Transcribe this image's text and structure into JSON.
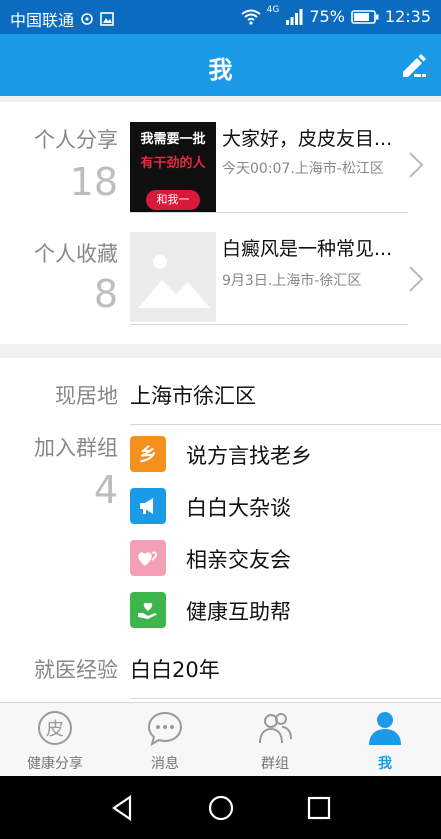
{
  "status_bar": {
    "carrier": "中国联通",
    "network": "4G",
    "battery": "75%",
    "time": "12:35"
  },
  "header": {
    "title": "我",
    "edit_icon": "edit-pencil-icon"
  },
  "share": {
    "label": "个人分享",
    "count": "18",
    "item_title": "大家好，皮皮友目...",
    "item_meta": "今天00:07.上海市-松江区",
    "thumb_lines": [
      "我需要一批",
      "有干劲的人",
      "和我一"
    ]
  },
  "favorite": {
    "label": "个人收藏",
    "count": "8",
    "item_title": "白癜风是一种常见...",
    "item_meta": "9月3日.上海市-徐汇区"
  },
  "residence": {
    "label": "现居地",
    "value": "上海市徐汇区"
  },
  "groups": {
    "label": "加入群组",
    "count": "4",
    "items": [
      {
        "name": "说方言找老乡",
        "icon": "hometown-icon",
        "color": "#f5901e",
        "glyph": "乡"
      },
      {
        "name": "白白大杂谈",
        "icon": "megaphone-icon",
        "color": "#1b9ae8"
      },
      {
        "name": "相亲交友会",
        "icon": "hearts-icon",
        "color": "#f4a0b4"
      },
      {
        "name": "健康互助帮",
        "icon": "helping-hand-icon",
        "color": "#3cb54a"
      }
    ]
  },
  "experience": {
    "label": "就医经验",
    "value": "白白20年"
  },
  "tabs": [
    {
      "label": "健康分享",
      "icon": "share-skin-icon",
      "glyph": "皮"
    },
    {
      "label": "消息",
      "icon": "message-bubble-icon"
    },
    {
      "label": "群组",
      "icon": "group-people-icon"
    },
    {
      "label": "我",
      "icon": "person-icon",
      "active": true
    }
  ],
  "colors": {
    "primary": "#1b9ae8",
    "status_bar": "#0a6bbf"
  }
}
